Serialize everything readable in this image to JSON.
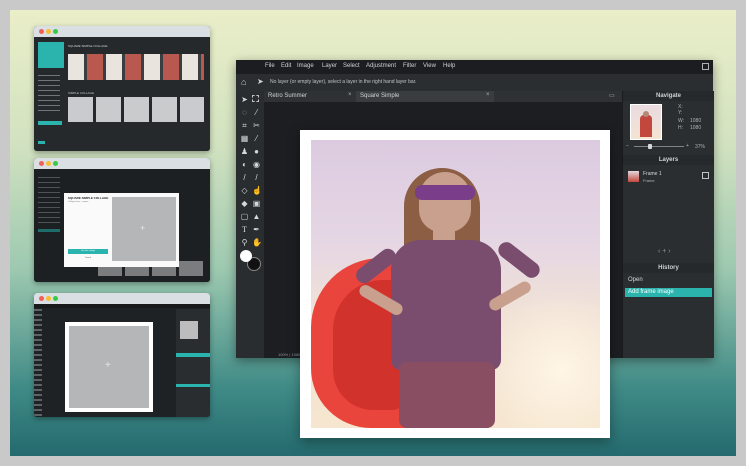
{
  "colors": {
    "accent": "#2bb3ae",
    "cape": "#e8372f",
    "mask": "#7a3d8a",
    "shirt": "#7a4d6e"
  },
  "mini1": {
    "title": "SQUARE SIMPLE COLLAGE",
    "sidebar_items": [
      "",
      "",
      "",
      "",
      "",
      ""
    ],
    "grid_label": "SIMPLE COLLAGE"
  },
  "mini2": {
    "dialog_title": "SQUARE SIMPLE COLLAGE",
    "dialog_sub": "Collage frame · square",
    "dialog_button": "Use this collage",
    "dialog_cancel": "Cancel"
  },
  "app": {
    "menu": [
      "File",
      "Edit",
      "Image",
      "Layer",
      "Select",
      "Adjustment",
      "Filter",
      "View",
      "Help"
    ],
    "hint": "No layer (or empty layer), select a layer in the right hand layer bar.",
    "tabs": [
      "Retro Summer",
      "Square Simple"
    ],
    "status": "100% | 1080x1080",
    "navigator": {
      "title": "Navigate",
      "w_label": "W:",
      "w_value": "1080",
      "h_label": "H:",
      "h_value": "1080",
      "x_label": "X:",
      "y_label": "Y:",
      "zoom": "37%"
    },
    "layers": {
      "title": "Layers",
      "items": [
        {
          "name": "Frame 1",
          "sub": "Frame"
        }
      ]
    },
    "history": {
      "title": "History",
      "items": [
        "Open",
        "Add frame image"
      ]
    }
  }
}
